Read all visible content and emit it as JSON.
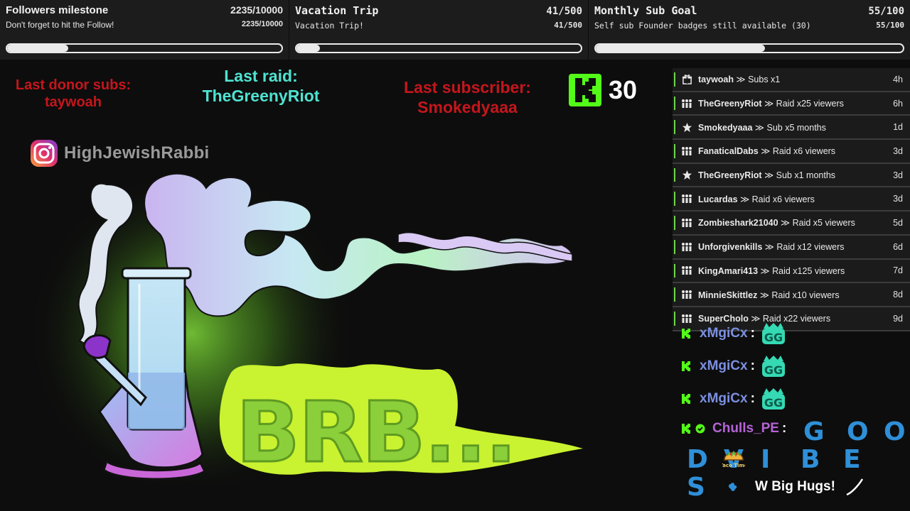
{
  "goals": [
    {
      "title": "Followers milestone",
      "sub": "Don't forget to hit the Follow!",
      "count": "2235/10000",
      "progress": 0.2235
    },
    {
      "title": "Vacation Trip",
      "sub": "Vacation Trip!",
      "count": "41/500",
      "progress": 0.082
    },
    {
      "title": "Monthly Sub Goal",
      "sub": "Self sub Founder badges still available (30)",
      "count": "55/100",
      "progress": 0.55
    }
  ],
  "labels": {
    "donor_title": "Last donor subs:",
    "donor_name": "taywoah",
    "raid_title": "Last raid:",
    "raid_name": "TheGreenyRiot",
    "sub_title": "Last subscriber:",
    "sub_name": "Smokedyaaa"
  },
  "kick_count": "30",
  "instagram_handle": "HighJewishRabbi",
  "brb_text": "BRB...",
  "events": [
    {
      "icon": "gift-icon",
      "who": "taywoah",
      "what": "Subs x1",
      "age": "4h"
    },
    {
      "icon": "raid-icon",
      "who": "TheGreenyRiot",
      "what": "Raid x25 viewers",
      "age": "6h"
    },
    {
      "icon": "star-icon",
      "who": "Smokedyaaa",
      "what": "Sub x5 months",
      "age": "1d"
    },
    {
      "icon": "raid-icon",
      "who": "FanaticalDabs",
      "what": "Raid x6 viewers",
      "age": "3d"
    },
    {
      "icon": "star-icon",
      "who": "TheGreenyRiot",
      "what": "Sub x1 months",
      "age": "3d"
    },
    {
      "icon": "raid-icon",
      "who": "Lucardas",
      "what": "Raid x6 viewers",
      "age": "3d"
    },
    {
      "icon": "raid-icon",
      "who": "Zombieshark21040",
      "what": "Raid x5 viewers",
      "age": "5d"
    },
    {
      "icon": "raid-icon",
      "who": "Unforgivenkills",
      "what": "Raid x12 viewers",
      "age": "6d"
    },
    {
      "icon": "raid-icon",
      "who": "KingAmari413",
      "what": "Raid x125 viewers",
      "age": "7d"
    },
    {
      "icon": "raid-icon",
      "who": "MinnieSkittlez",
      "what": "Raid x10 viewers",
      "age": "8d"
    },
    {
      "icon": "raid-icon",
      "who": "SuperCholo",
      "what": "Raid x22 viewers",
      "age": "9d"
    }
  ],
  "chat": {
    "lines": [
      {
        "user": "xMgiCx",
        "color": "#7b8fe0",
        "emote": "GG"
      },
      {
        "user": "xMgiCx",
        "color": "#7b8fe0",
        "emote": "GG"
      },
      {
        "user": "xMgiCx",
        "color": "#7b8fe0",
        "emote": "GG"
      }
    ],
    "last_user": "Chulls_PE",
    "last_user_color": "#b564d6",
    "vibe_letters": [
      "G",
      "O",
      "O",
      "D",
      "V",
      "I",
      "B",
      "E",
      "S"
    ],
    "hugs_text": "W Big Hugs!",
    "taco_emote_text": "Taco Time"
  },
  "colors": {
    "kick_green": "#53fc18",
    "label_red": "#c4161c",
    "label_cyan": "#4fe3d1",
    "vibe_blue": "#2f8fd8"
  }
}
